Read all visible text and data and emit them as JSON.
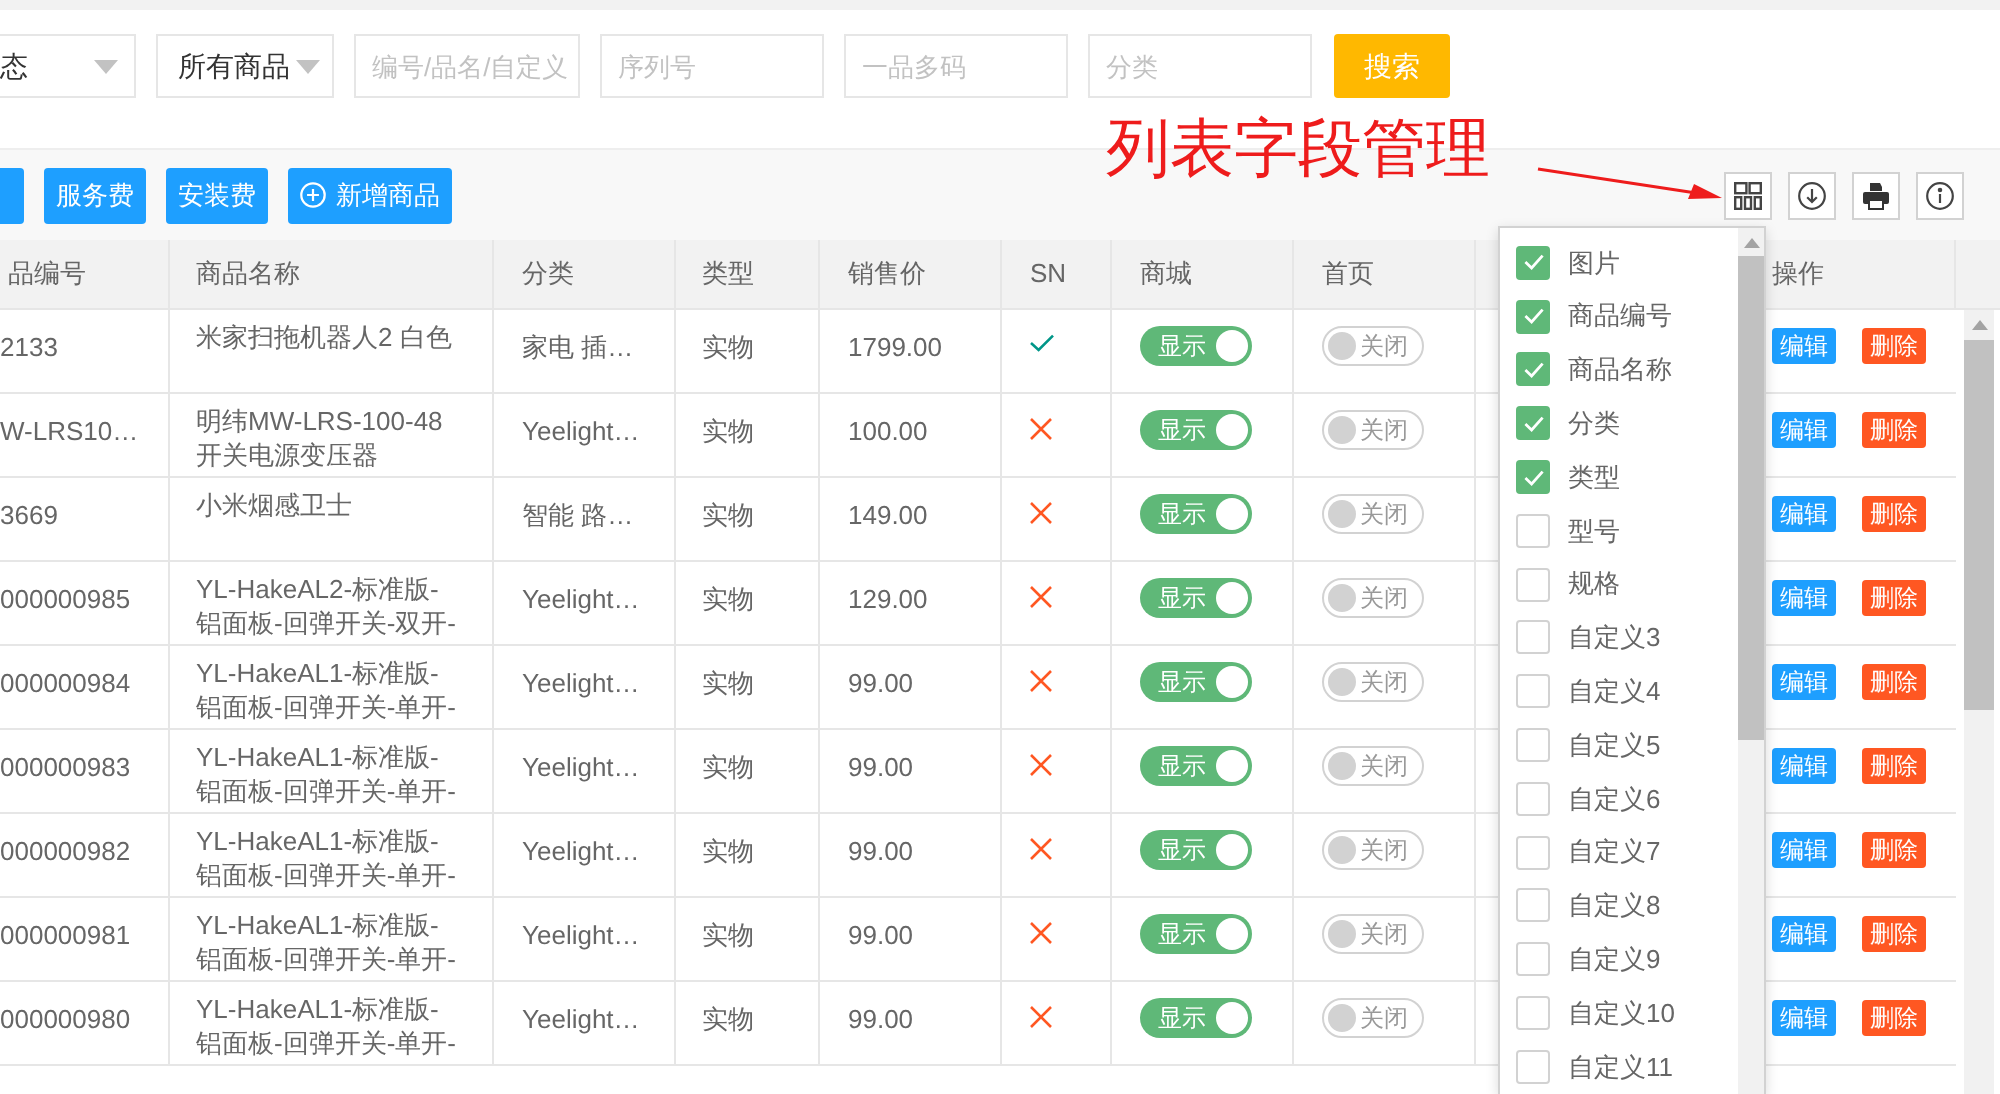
{
  "filters": {
    "selects": [
      {
        "value": "态"
      },
      {
        "value": "所有商品"
      }
    ],
    "fields": [
      {
        "placeholder": "编号/品名/自定义"
      },
      {
        "placeholder": "序列号"
      },
      {
        "placeholder": "一品多码"
      },
      {
        "placeholder": "分类"
      }
    ],
    "search_button": "搜索"
  },
  "annotation": {
    "text": "列表字段管理"
  },
  "toolbar": {
    "buttons": [
      {
        "kind": "cut"
      },
      {
        "kind": "text",
        "label": "服务费"
      },
      {
        "kind": "text",
        "label": "安装费"
      },
      {
        "kind": "add",
        "label": "新增商品"
      }
    ],
    "tools": [
      {
        "kind": "columns"
      },
      {
        "kind": "download"
      },
      {
        "kind": "print"
      },
      {
        "kind": "info"
      }
    ]
  },
  "table": {
    "columns": [
      {
        "label": "品编号"
      },
      {
        "label": "商品名称"
      },
      {
        "label": "分类"
      },
      {
        "label": "类型"
      },
      {
        "label": "销售价"
      },
      {
        "label": "SN"
      },
      {
        "label": "商城"
      },
      {
        "label": "首页"
      },
      {
        "label": "操作"
      }
    ],
    "rows": [
      {
        "code": "2133",
        "name": [
          "米家扫拖机器人2 白色"
        ],
        "category": "家电 插…",
        "type": "实物",
        "price": "1799.00",
        "sn": true,
        "mall": {
          "label": "显示",
          "on": true
        },
        "home": {
          "label": "关闭",
          "on": false
        },
        "actions": [
          {
            "kind": "edit",
            "label": "编辑"
          },
          {
            "kind": "delete",
            "label": "删除"
          }
        ]
      },
      {
        "code": "W-LRS10…",
        "name": [
          "明纬MW-LRS-100-48",
          "开关电源变压器"
        ],
        "category": "Yeelight…",
        "type": "实物",
        "price": "100.00",
        "sn": false,
        "mall": {
          "label": "显示",
          "on": true
        },
        "home": {
          "label": "关闭",
          "on": false
        },
        "actions": [
          {
            "kind": "edit",
            "label": "编辑"
          },
          {
            "kind": "delete",
            "label": "删除"
          }
        ]
      },
      {
        "code": "3669",
        "name": [
          "小米烟感卫士"
        ],
        "category": "智能 路…",
        "type": "实物",
        "price": "149.00",
        "sn": false,
        "mall": {
          "label": "显示",
          "on": true
        },
        "home": {
          "label": "关闭",
          "on": false
        },
        "actions": [
          {
            "kind": "edit",
            "label": "编辑"
          },
          {
            "kind": "delete",
            "label": "删除"
          }
        ]
      },
      {
        "code": "000000985",
        "name": [
          "YL-HakeAL2-标准版-",
          "铝面板-回弹开关-双开-"
        ],
        "category": "Yeelight…",
        "type": "实物",
        "price": "129.00",
        "sn": false,
        "mall": {
          "label": "显示",
          "on": true
        },
        "home": {
          "label": "关闭",
          "on": false
        },
        "actions": [
          {
            "kind": "edit",
            "label": "编辑"
          },
          {
            "kind": "delete",
            "label": "删除"
          }
        ]
      },
      {
        "code": "000000984",
        "name": [
          "YL-HakeAL1-标准版-",
          "铝面板-回弹开关-单开-"
        ],
        "category": "Yeelight…",
        "type": "实物",
        "price": "99.00",
        "sn": false,
        "mall": {
          "label": "显示",
          "on": true
        },
        "home": {
          "label": "关闭",
          "on": false
        },
        "actions": [
          {
            "kind": "edit",
            "label": "编辑"
          },
          {
            "kind": "delete",
            "label": "删除"
          }
        ]
      },
      {
        "code": "000000983",
        "name": [
          "YL-HakeAL1-标准版-",
          "铝面板-回弹开关-单开-"
        ],
        "category": "Yeelight…",
        "type": "实物",
        "price": "99.00",
        "sn": false,
        "mall": {
          "label": "显示",
          "on": true
        },
        "home": {
          "label": "关闭",
          "on": false
        },
        "actions": [
          {
            "kind": "edit",
            "label": "编辑"
          },
          {
            "kind": "delete",
            "label": "删除"
          }
        ]
      },
      {
        "code": "000000982",
        "name": [
          "YL-HakeAL1-标准版-",
          "铝面板-回弹开关-单开-"
        ],
        "category": "Yeelight…",
        "type": "实物",
        "price": "99.00",
        "sn": false,
        "mall": {
          "label": "显示",
          "on": true
        },
        "home": {
          "label": "关闭",
          "on": false
        },
        "actions": [
          {
            "kind": "edit",
            "label": "编辑"
          },
          {
            "kind": "delete",
            "label": "删除"
          }
        ]
      },
      {
        "code": "000000981",
        "name": [
          "YL-HakeAL1-标准版-",
          "铝面板-回弹开关-单开-"
        ],
        "category": "Yeelight…",
        "type": "实物",
        "price": "99.00",
        "sn": false,
        "mall": {
          "label": "显示",
          "on": true
        },
        "home": {
          "label": "关闭",
          "on": false
        },
        "actions": [
          {
            "kind": "edit",
            "label": "编辑"
          },
          {
            "kind": "delete",
            "label": "删除"
          }
        ]
      },
      {
        "code": "000000980",
        "name": [
          "YL-HakeAL1-标准版-",
          "铝面板-回弹开关-单开-"
        ],
        "category": "Yeelight…",
        "type": "实物",
        "price": "99.00",
        "sn": false,
        "mall": {
          "label": "显示",
          "on": true
        },
        "home": {
          "label": "关闭",
          "on": false
        },
        "actions": [
          {
            "kind": "edit",
            "label": "编辑"
          },
          {
            "kind": "delete",
            "label": "删除"
          }
        ]
      }
    ]
  },
  "column_menu": {
    "items": [
      {
        "label": "图片",
        "checked": true
      },
      {
        "label": "商品编号",
        "checked": true
      },
      {
        "label": "商品名称",
        "checked": true
      },
      {
        "label": "分类",
        "checked": true
      },
      {
        "label": "类型",
        "checked": true
      },
      {
        "label": "型号",
        "checked": false
      },
      {
        "label": "规格",
        "checked": false
      },
      {
        "label": "自定义3",
        "checked": false
      },
      {
        "label": "自定义4",
        "checked": false
      },
      {
        "label": "自定义5",
        "checked": false
      },
      {
        "label": "自定义6",
        "checked": false
      },
      {
        "label": "自定义7",
        "checked": false
      },
      {
        "label": "自定义8",
        "checked": false
      },
      {
        "label": "自定义9",
        "checked": false
      },
      {
        "label": "自定义10",
        "checked": false
      },
      {
        "label": "自定义11",
        "checked": false
      }
    ]
  }
}
